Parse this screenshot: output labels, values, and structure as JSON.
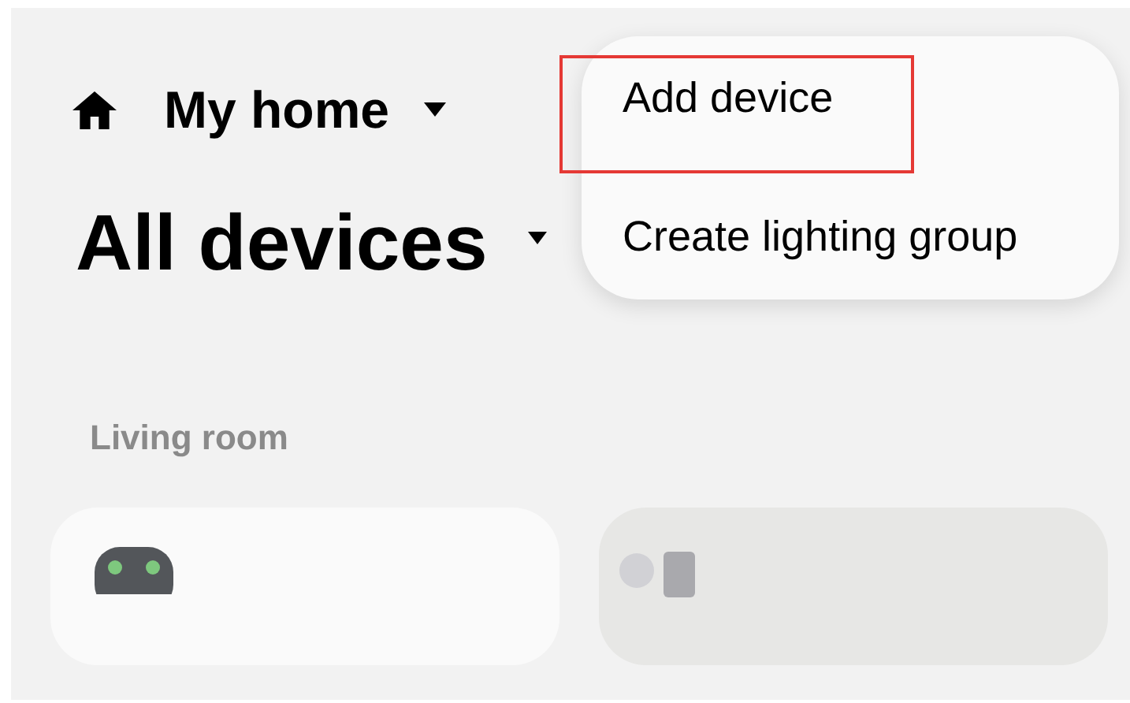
{
  "header": {
    "home_name": "My home"
  },
  "menu": {
    "items": [
      {
        "label": "Add device",
        "highlighted": true
      },
      {
        "label": "Create lighting group",
        "highlighted": false
      }
    ]
  },
  "title": "All devices",
  "section": {
    "label": "Living room",
    "cards": [
      {
        "kind": "robot",
        "on": true
      },
      {
        "kind": "switch",
        "on": false
      }
    ]
  }
}
